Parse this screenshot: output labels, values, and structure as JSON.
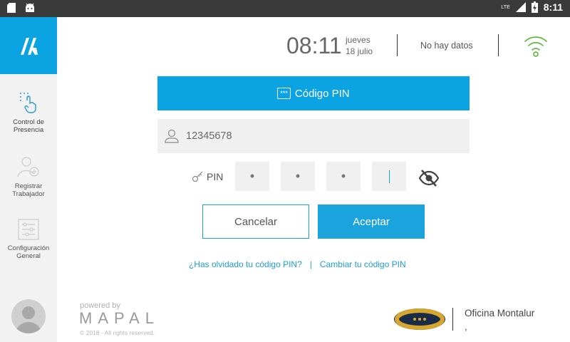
{
  "status_bar": {
    "network": "LTE",
    "time": "8:11",
    "colors": {
      "background": "#3a3a3a"
    },
    "icons": [
      "sd-card-icon",
      "android-icon",
      "signal-icon",
      "battery-charging-icon"
    ]
  },
  "sidebar": {
    "items": [
      {
        "label_line1": "Control de",
        "label_line2": "Presencia",
        "icon": "touch-icon",
        "active": true
      },
      {
        "label_line1": "Registrar",
        "label_line2": "Trabajador",
        "icon": "add-user-icon",
        "active": false
      },
      {
        "label_line1": "Configuración",
        "label_line2": "General",
        "icon": "settings-list-icon",
        "active": false
      }
    ]
  },
  "header": {
    "time": "08:11",
    "weekday": "jueves",
    "date": "18 julio",
    "status": "No hay datos"
  },
  "pin_card": {
    "title": "Código PIN",
    "title_badge": "***",
    "user_value": "12345678",
    "pin_label": "PIN",
    "pin_digits": [
      "•",
      "•",
      "•",
      ""
    ],
    "cancel_label": "Cancelar",
    "accept_label": "Aceptar",
    "forgot_link": "¿Has olvidado tu código PIN?",
    "link_separator": "|",
    "change_link": "Cambiar tu código PIN"
  },
  "footer": {
    "powered_by": "powered by",
    "brand": "MAPAL",
    "copyright": "© 2018 - All rights reserved.",
    "office_name": "Oficina Montalur",
    "office_sub": ","
  },
  "colors": {
    "accent": "#0ba3e2",
    "wifi": "#5cb531",
    "sidebar_bg": "#f2f2f2",
    "field_bg": "#f0f0f0"
  }
}
